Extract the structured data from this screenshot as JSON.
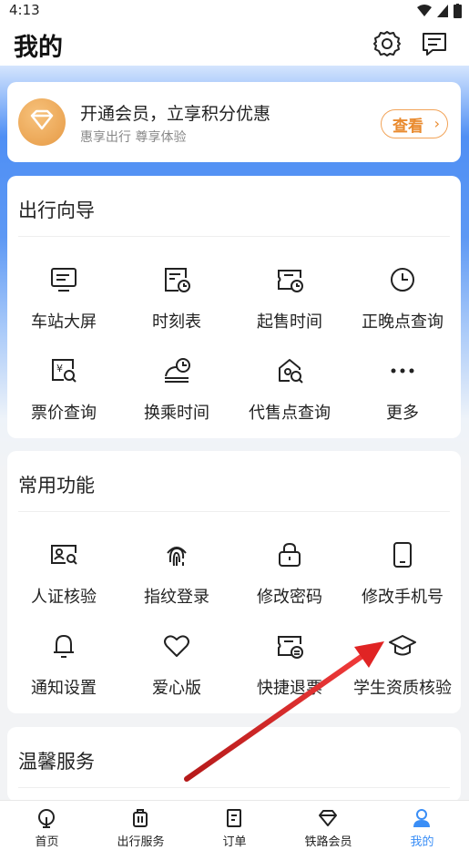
{
  "status": {
    "time": "4:13"
  },
  "header": {
    "title": "我的",
    "settings_icon": "gear-icon",
    "message_icon": "message-icon"
  },
  "vip": {
    "title": "开通会员，立享积分优惠",
    "subtitle": "惠享出行 尊享体验",
    "button": "查看",
    "chevron": "›"
  },
  "travel_guide": {
    "title": "出行向导",
    "items": [
      {
        "label": "车站大屏",
        "icon": "station-screen-icon"
      },
      {
        "label": "时刻表",
        "icon": "timetable-icon"
      },
      {
        "label": "起售时间",
        "icon": "sale-time-icon"
      },
      {
        "label": "正晚点查询",
        "icon": "clock-icon"
      },
      {
        "label": "票价查询",
        "icon": "fare-search-icon"
      },
      {
        "label": "换乘时间",
        "icon": "transfer-time-icon"
      },
      {
        "label": "代售点查询",
        "icon": "agency-search-icon"
      },
      {
        "label": "更多",
        "icon": "more-icon"
      }
    ]
  },
  "common_functions": {
    "title": "常用功能",
    "items": [
      {
        "label": "人证核验",
        "icon": "id-verify-icon"
      },
      {
        "label": "指纹登录",
        "icon": "fingerprint-icon"
      },
      {
        "label": "修改密码",
        "icon": "lock-icon"
      },
      {
        "label": "修改手机号",
        "icon": "phone-icon"
      },
      {
        "label": "通知设置",
        "icon": "bell-icon"
      },
      {
        "label": "爱心版",
        "icon": "heart-icon"
      },
      {
        "label": "快捷退票",
        "icon": "refund-ticket-icon"
      },
      {
        "label": "学生资质核验",
        "icon": "graduation-cap-icon"
      }
    ]
  },
  "warm_service": {
    "title": "温馨服务"
  },
  "bottom_nav": {
    "items": [
      {
        "label": "首页",
        "icon": "home-icon"
      },
      {
        "label": "出行服务",
        "icon": "luggage-icon"
      },
      {
        "label": "订单",
        "icon": "order-icon"
      },
      {
        "label": "铁路会员",
        "icon": "diamond-icon"
      },
      {
        "label": "我的",
        "icon": "person-icon"
      }
    ],
    "active_color": "#3a8ef6"
  },
  "colors": {
    "accent": "#3a8ef6",
    "vip_orange": "#e98a2e",
    "annotation_arrow": "#e02424"
  }
}
